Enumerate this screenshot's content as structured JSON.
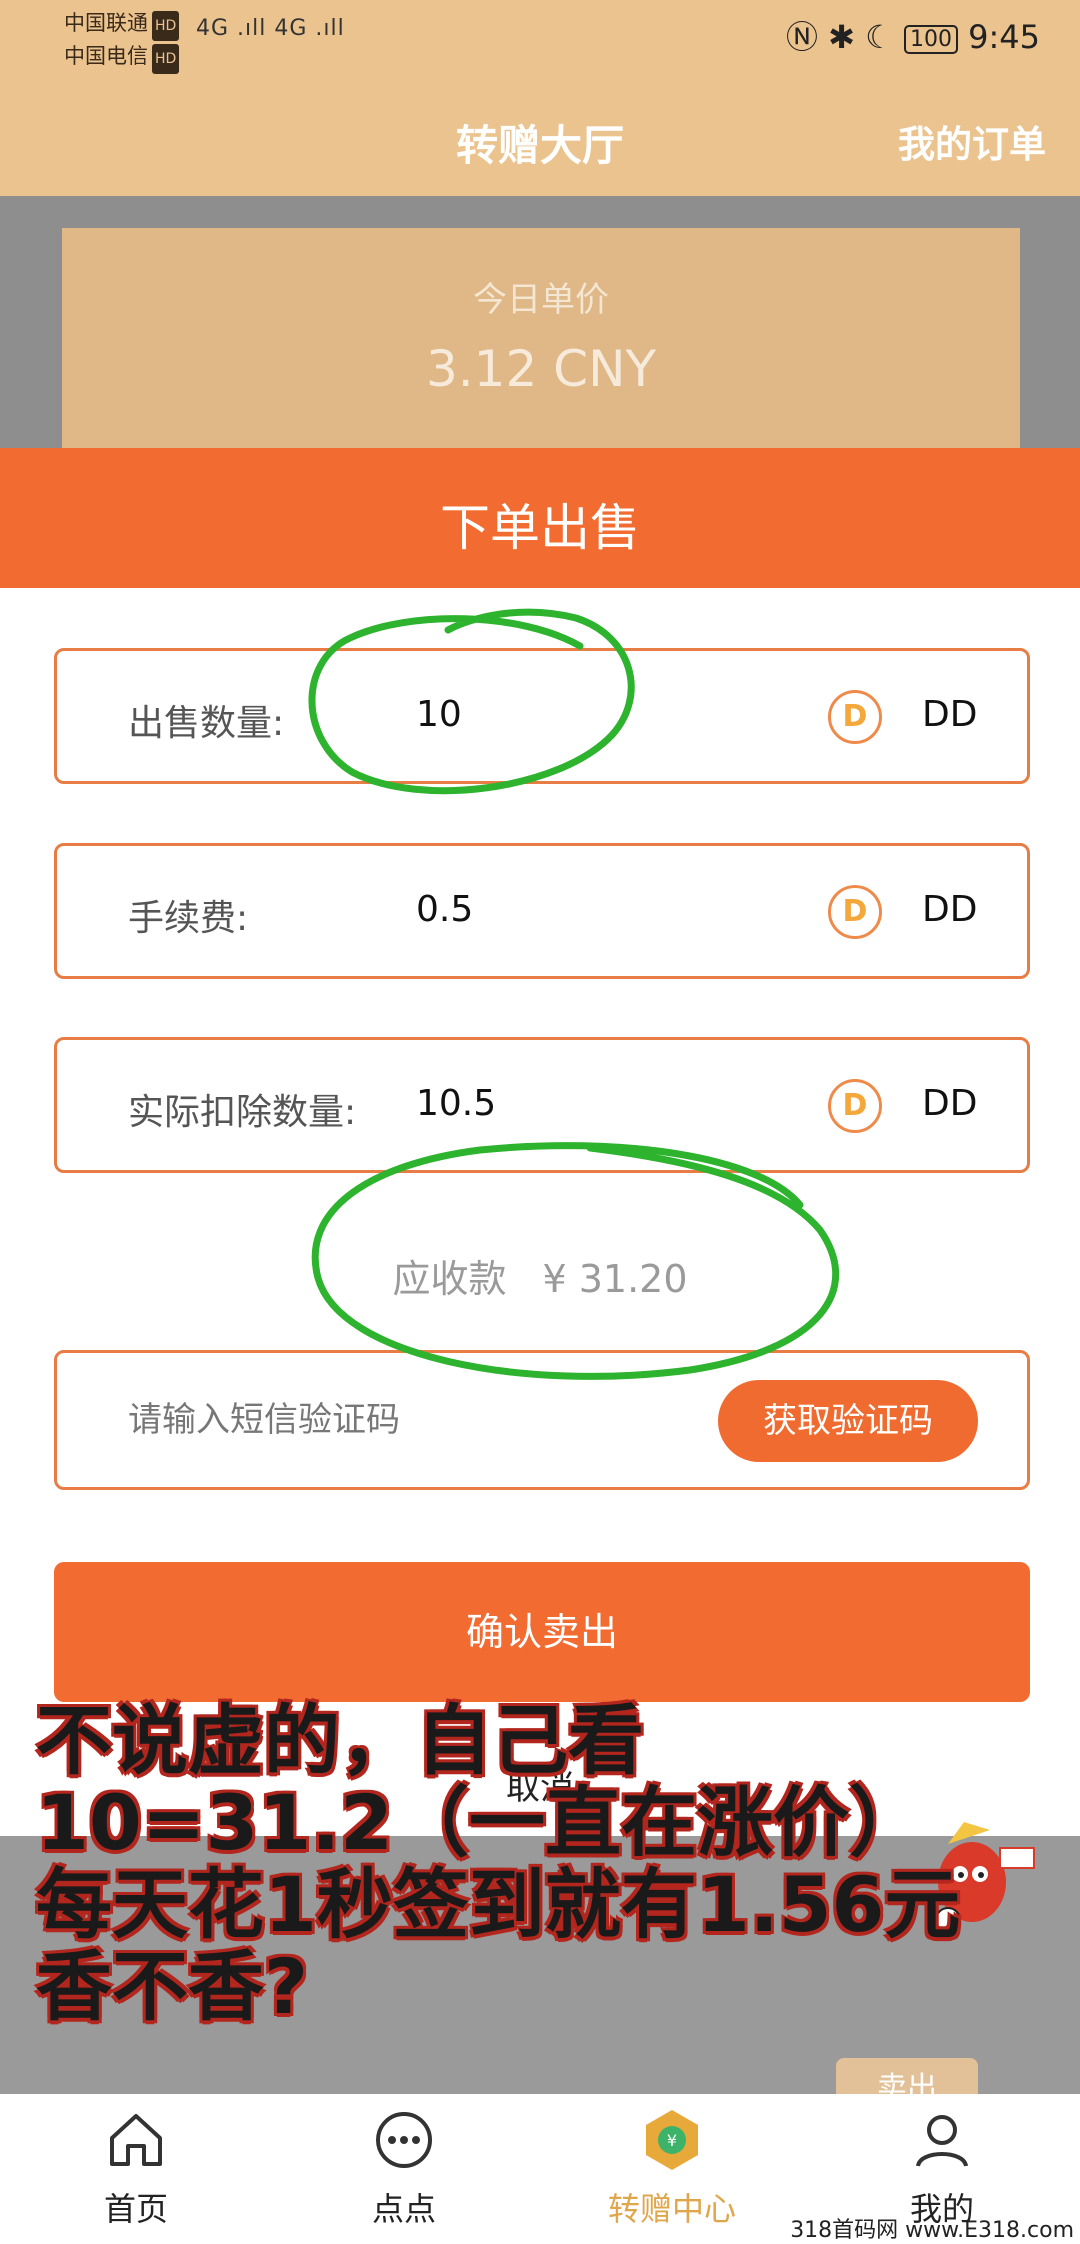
{
  "status_bar": {
    "carrier_1": "中国联通",
    "carrier_2": "中国电信",
    "hd": "HD",
    "signal": "4G .ıll 4G .ıll",
    "battery": "100",
    "time": "9:45"
  },
  "header": {
    "title": "转赠大厅",
    "orders_link": "我的订单"
  },
  "price_card": {
    "label": "今日单价",
    "value": "3.12 CNY"
  },
  "sheet": {
    "title": "下单出售",
    "rows": [
      {
        "label": "出售数量:",
        "value": "10",
        "unit": "DD"
      },
      {
        "label": "手续费:",
        "value": "0.5",
        "unit": "DD"
      },
      {
        "label": "实际扣除数量:",
        "value": "10.5",
        "unit": "DD"
      }
    ],
    "coin_letter": "D",
    "receivable_label": "应收款",
    "receivable_value": "¥ 31.20",
    "code_placeholder": "请输入短信验证码",
    "get_code_button": "获取验证码",
    "confirm_button": "确认卖出",
    "cancel_button": "取消"
  },
  "background_list": {
    "sell_button": "卖出"
  },
  "caption": {
    "line1": "不说虚的，自己看",
    "line2": "10=31.2（一直在涨价）",
    "line3": "每天花1秒签到就有1.56元",
    "line4": "香不香?"
  },
  "bottom_nav": {
    "items": [
      {
        "label": "首页",
        "icon": "home-icon"
      },
      {
        "label": "点点",
        "icon": "chat-dots-icon"
      },
      {
        "label": "转赠中心",
        "icon": "transfer-center-icon"
      },
      {
        "label": "我的",
        "icon": "profile-icon"
      }
    ],
    "active_index": 2
  },
  "watermark": "318首码网 www.E318.com",
  "colors": {
    "header": "#ebc38f",
    "accent": "#f26b30",
    "active_nav": "#e0a64b",
    "annotation": "#2db32d"
  }
}
